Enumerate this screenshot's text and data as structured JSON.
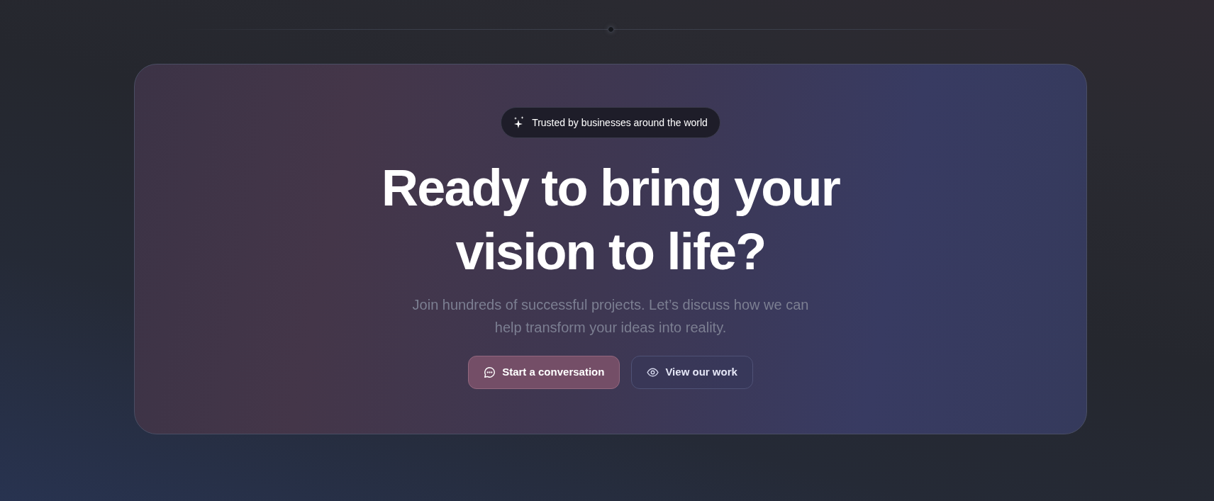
{
  "badge": {
    "text": "Trusted by businesses around the world"
  },
  "heading": "Ready to bring your vision to life?",
  "description": "Join hundreds of successful projects. Let’s discuss how we can help transform your ideas into reality.",
  "buttons": [
    {
      "label": "Start a conversation",
      "kind": "primary"
    },
    {
      "label": "View our work",
      "kind": "secondary"
    }
  ]
}
